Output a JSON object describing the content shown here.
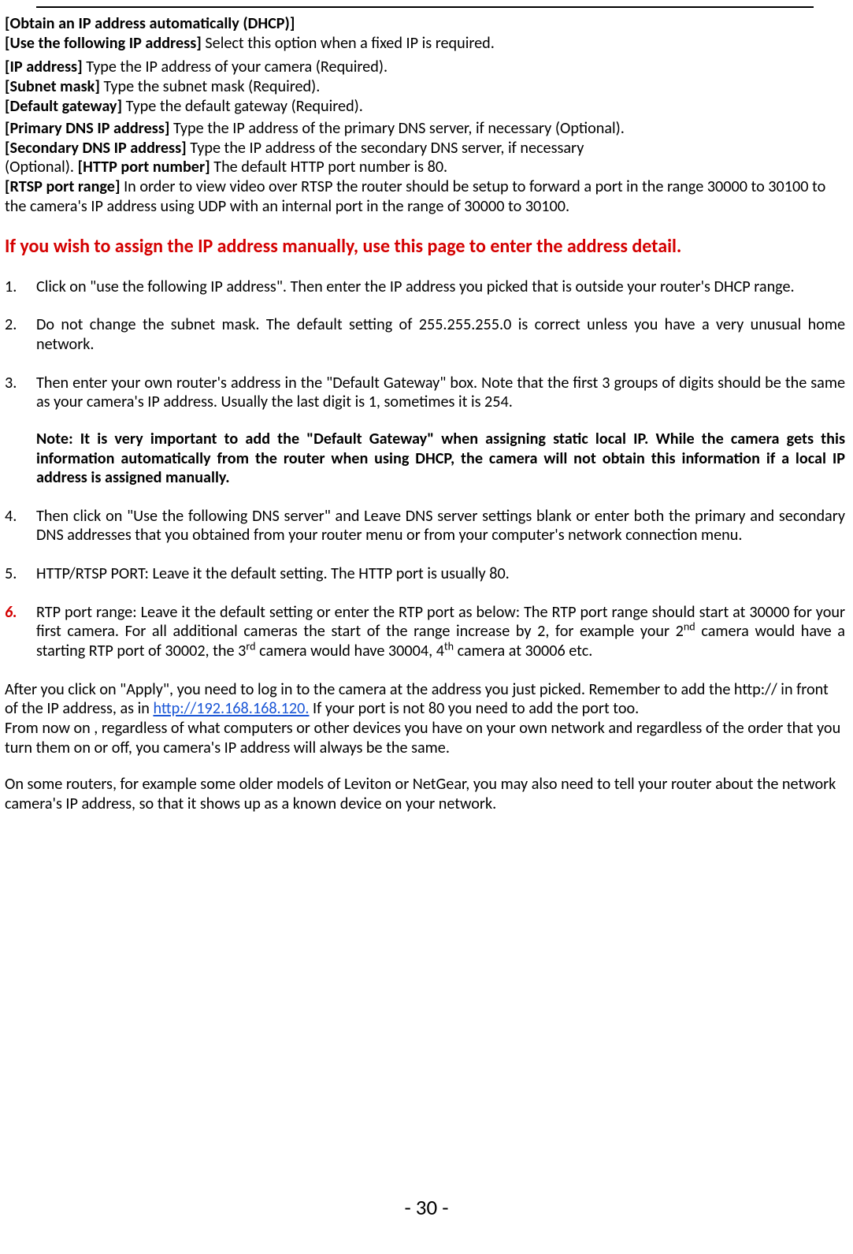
{
  "defs": {
    "dhcp": {
      "label": "[Obtain an IP address automatically (DHCP)]"
    },
    "useip": {
      "label": "[Use the following IP address] ",
      "desc": "Select this option when a fixed IP is required."
    },
    "ip": {
      "label": "[IP address] ",
      "desc": "Type the IP address of your camera (Required)."
    },
    "subnet": {
      "label": "[Subnet mask] ",
      "desc": "Type the subnet mask (Required)."
    },
    "gateway": {
      "label": "[Default gateway] ",
      "desc": "Type the default gateway (Required)."
    },
    "pdns": {
      "label": "[Primary DNS IP address] ",
      "desc": "Type the IP address of the primary DNS server, if necessary (Optional)."
    },
    "sdns": {
      "label": "[Secondary DNS IP address] ",
      "desc_line1": "Type the IP address of the secondary DNS server, if necessary",
      "desc_line2_pre": "(Optional). "
    },
    "http": {
      "label": "[HTTP port number] ",
      "desc": "The default HTTP port number is 80."
    },
    "rtsp": {
      "label": "[RTSP port range] ",
      "desc": "In order to view video over RTSP the router should be setup to forward a port in the range 30000 to 30100 to the camera's IP address using UDP with an internal port in the range of 30000 to 30100."
    }
  },
  "heading": "If you wish to assign the IP address manually, use this page to enter the address detail.",
  "steps": {
    "s1": "Click on \"use the following IP address\". Then enter the IP address you picked that is outside your router's DHCP range.",
    "s2": "Do not change the subnet mask. The default setting of 255.255.255.0 is correct unless you have a very unusual home network.",
    "s3": "Then enter your own router's address in the \"Default Gateway\" box. Note that the first 3 groups of digits should be the same as your camera's IP address. Usually the last digit is 1, sometimes it is 254.",
    "note": "Note: It is very important to add the \"Default Gateway\" when assigning static local IP. While the camera gets this information automatically from the router when using DHCP, the camera will not obtain this information if a local IP address is assigned manually.",
    "s4": "Then click on \"Use the following DNS server\" and Leave DNS server settings blank or enter both the primary and secondary DNS addresses that you obtained from your router menu or from your computer's network connection menu.",
    "s5": "HTTP/RTSP PORT: Leave it the default setting. The HTTP port is usually 80.",
    "s6_a": "RTP port range: Leave it the default setting or enter the RTP port as below: The RTP port range should start at 30000 for your first camera. For all additional cameras the start of the range increase by 2, for example your 2",
    "s6_nd": "nd",
    "s6_b": " camera would have a starting RTP port of 30002, the 3",
    "s6_rd": "rd",
    "s6_c": " camera would have 30004, 4",
    "s6_th": "th",
    "s6_d": " camera at 30006 etc."
  },
  "after": {
    "p1_a": "After you click on \"Apply\", you need to log in to the camera at the address you just picked. Remember to add the http:// in front of the IP address, as in    ",
    "link": "http://192.168.168.120.",
    "p1_b": " If your port is not 80 you need to add the port too.",
    "p2": "From now on , regardless of what computers or other devices you have on your own network and regardless of the order that you turn them on or off, you camera's IP address will always be the same.",
    "p3": "On some routers, for example some older models of Leviton or NetGear, you may also need to tell your router about the network camera's IP address, so that it shows up as a known device on your network."
  },
  "footer": "- 30 -"
}
